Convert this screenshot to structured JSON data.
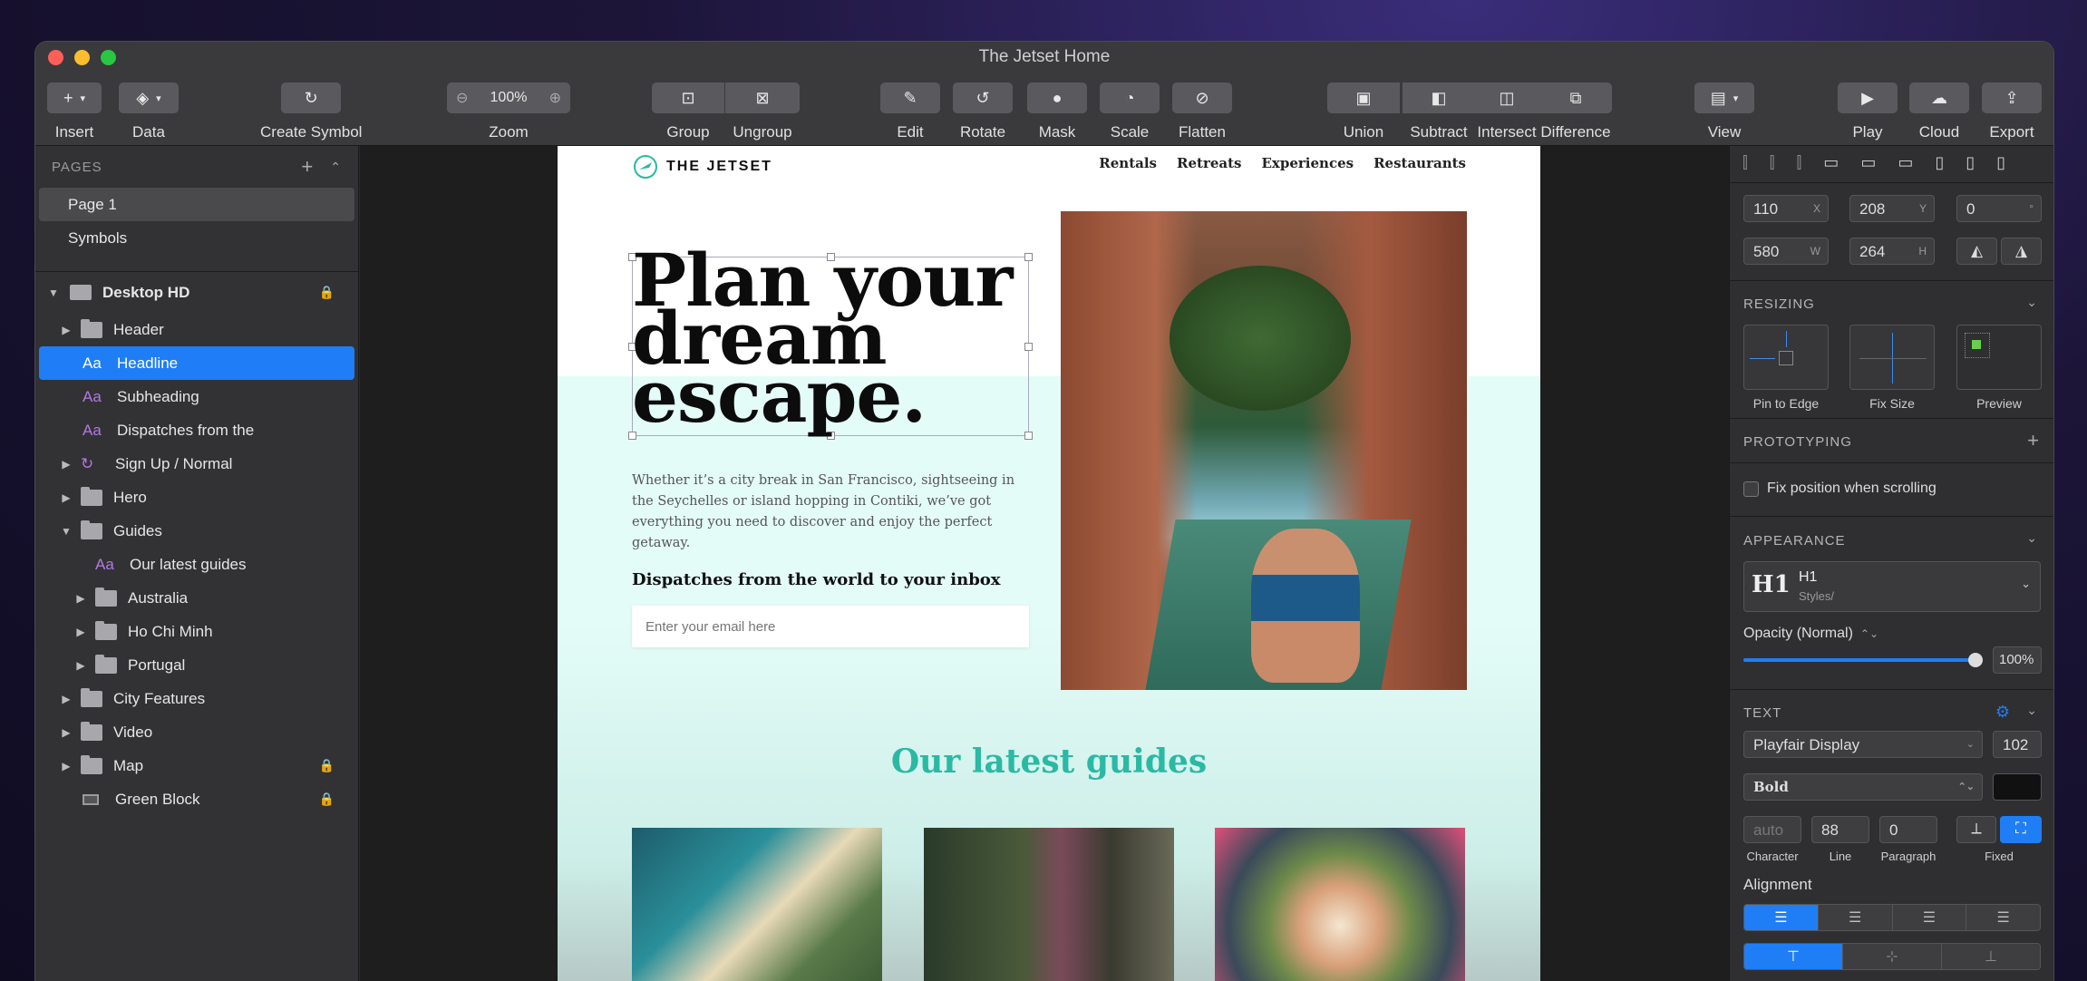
{
  "window": {
    "title": "The Jetset Home"
  },
  "toolbar": {
    "insert": "Insert",
    "data": "Data",
    "create_symbol": "Create Symbol",
    "zoom": "Zoom",
    "zoom_value": "100%",
    "group": "Group",
    "ungroup": "Ungroup",
    "edit": "Edit",
    "rotate": "Rotate",
    "mask": "Mask",
    "scale": "Scale",
    "flatten": "Flatten",
    "union": "Union",
    "subtract": "Subtract",
    "intersect": "Intersect",
    "difference": "Difference",
    "view": "View",
    "play": "Play",
    "cloud": "Cloud",
    "export": "Export"
  },
  "pages": {
    "header": "PAGES",
    "items": [
      "Page 1",
      "Symbols"
    ]
  },
  "layers": {
    "artboard": "Desktop HD",
    "items": [
      "Header",
      "Headline",
      "Subheading",
      "Dispatches from the",
      "Sign Up / Normal",
      "Hero",
      "Guides",
      "Our latest guides",
      "Australia",
      "Ho Chi Minh",
      "Portugal",
      "City Features",
      "Video",
      "Map",
      "Green Block"
    ]
  },
  "site": {
    "logo": "THE JETSET",
    "nav": [
      "Rentals",
      "Retreats",
      "Experiences",
      "Restaurants"
    ],
    "headline": [
      "Plan your",
      "dream",
      "escape."
    ],
    "subheading": "Whether it’s a city break in San Francisco, sightseeing in the Seychelles or island hopping in Contiki, we’ve got everything you need to discover and enjoy the perfect getaway.",
    "dispatch_title": "Dispatches from the world to your inbox",
    "email_placeholder": "Enter your email here",
    "guides_title": "Our latest guides"
  },
  "inspector": {
    "x": "110",
    "y": "208",
    "rotation": "0",
    "w": "580",
    "h": "264",
    "x_label": "X",
    "y_label": "Y",
    "deg": "°",
    "w_label": "W",
    "h_label": "H",
    "resizing": "RESIZING",
    "pin": "Pin to Edge",
    "fix_size": "Fix Size",
    "preview": "Preview",
    "prototyping": "PROTOTYPING",
    "fix_position": "Fix position when scrolling",
    "appearance": "APPEARANCE",
    "style_name": "H1",
    "style_path": "Styles/",
    "style_glyph": "H1",
    "opacity_label": "Opacity (Normal)",
    "opacity_value": "100%",
    "opacity_level": 1.0,
    "text": "TEXT",
    "font": "Playfair Display",
    "size": "102",
    "weight": "Bold",
    "text_color": "#111111",
    "character": "auto",
    "line": "88",
    "paragraph": "0",
    "character_label": "Character",
    "line_label": "Line",
    "paragraph_label": "Paragraph",
    "fixed_label": "Fixed",
    "alignment": "Alignment"
  },
  "colors": {
    "accent": "#1f7ef5",
    "teal": "#2bb9a4",
    "mint": "#e4fcf8"
  }
}
